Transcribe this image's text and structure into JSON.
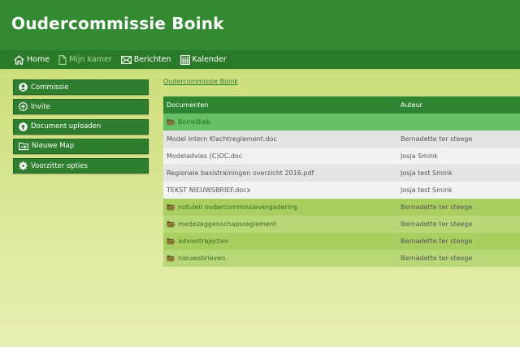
{
  "header": {
    "title": "Oudercommissie Boink"
  },
  "nav": {
    "items": [
      {
        "label": "Home",
        "icon": "home-icon"
      },
      {
        "label": "Mijn kamer",
        "icon": "document-icon"
      },
      {
        "label": "Berichten",
        "icon": "envelope-icon"
      },
      {
        "label": "Kalender",
        "icon": "calendar-icon"
      }
    ],
    "active": "Mijn kamer"
  },
  "sidebar": {
    "items": [
      {
        "label": "Commissie",
        "icon": "user-icon"
      },
      {
        "label": "Invite",
        "icon": "plus-circle-icon"
      },
      {
        "label": "Document uploaden",
        "icon": "upload-icon"
      },
      {
        "label": "Nieuwe Map",
        "icon": "folder-add-icon"
      },
      {
        "label": "Voorzitter opties",
        "icon": "gear-icon"
      }
    ]
  },
  "breadcrumb": "Oudercommissie Boink",
  "table": {
    "headers": [
      "Documenten",
      "Auteur"
    ],
    "rows": [
      {
        "name": "BoinkBieb",
        "author": "",
        "kind": "folder"
      },
      {
        "name": "Model Intern Klachtreglement.doc",
        "author": "Bernadette ter steege",
        "kind": "file"
      },
      {
        "name": "Modeladvies (C)OC.doc",
        "author": "Josja Smink",
        "kind": "file"
      },
      {
        "name": "Regionale basistrainingen overzicht 2016.pdf",
        "author": "Josja test Smink",
        "kind": "file"
      },
      {
        "name": "TEKST NIEUWSBRIEF.docx",
        "author": "Josja test Smink",
        "kind": "file"
      },
      {
        "name": "notulen oudercommissievergadering",
        "author": "Bernadette ter steege",
        "kind": "folder"
      },
      {
        "name": "medezeggenschapsreglement",
        "author": "Bernadette ter steege",
        "kind": "folder"
      },
      {
        "name": "adviestrajecten",
        "author": "Bernadette ter steege",
        "kind": "folder"
      },
      {
        "name": "nieuwsbrieven",
        "author": "Bernadette ter steege",
        "kind": "folder"
      }
    ]
  },
  "colors": {
    "header": "#338a33",
    "navbar": "#2a7a2a",
    "nav_active": "#a9dc8e",
    "table_header": "#2f8532",
    "root_folder_row": "#66c166",
    "folder_row": "#a9cf60",
    "folder_icon": "#6b5a2a"
  }
}
